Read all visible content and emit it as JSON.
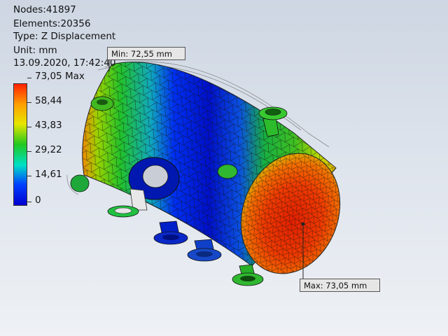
{
  "info": {
    "nodes": "Nodes:41897",
    "elements": "Elements:20356",
    "type": "Type: Z Displacement",
    "unit": "Unit: mm",
    "datetime": "13.09.2020, 17:42:40"
  },
  "legend": {
    "max_label": "73,05 Max",
    "ticks": [
      "58,44",
      "43,83",
      "29,22",
      "14,61",
      "0"
    ],
    "colors": [
      "#ff2000",
      "#ffa000",
      "#e6e600",
      "#20c820",
      "#00e0c8",
      "#0040ff",
      "#0000d0"
    ]
  },
  "probes": {
    "min": "Min: 72,55 mm",
    "max": "Max: 73,05 mm"
  },
  "colors": {
    "background_top": "#cdd6e2",
    "background_bottom": "#eef1f5",
    "mesh_line": "#1a1a1a"
  }
}
